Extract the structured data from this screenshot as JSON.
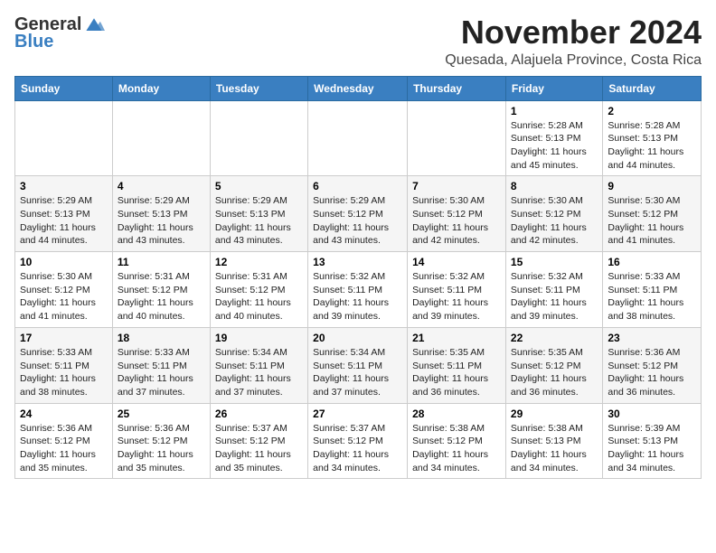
{
  "logo": {
    "general": "General",
    "blue": "Blue"
  },
  "header": {
    "month": "November 2024",
    "location": "Quesada, Alajuela Province, Costa Rica"
  },
  "weekdays": [
    "Sunday",
    "Monday",
    "Tuesday",
    "Wednesday",
    "Thursday",
    "Friday",
    "Saturday"
  ],
  "weeks": [
    [
      {
        "day": "",
        "info": ""
      },
      {
        "day": "",
        "info": ""
      },
      {
        "day": "",
        "info": ""
      },
      {
        "day": "",
        "info": ""
      },
      {
        "day": "",
        "info": ""
      },
      {
        "day": "1",
        "info": "Sunrise: 5:28 AM\nSunset: 5:13 PM\nDaylight: 11 hours\nand 45 minutes."
      },
      {
        "day": "2",
        "info": "Sunrise: 5:28 AM\nSunset: 5:13 PM\nDaylight: 11 hours\nand 44 minutes."
      }
    ],
    [
      {
        "day": "3",
        "info": "Sunrise: 5:29 AM\nSunset: 5:13 PM\nDaylight: 11 hours\nand 44 minutes."
      },
      {
        "day": "4",
        "info": "Sunrise: 5:29 AM\nSunset: 5:13 PM\nDaylight: 11 hours\nand 43 minutes."
      },
      {
        "day": "5",
        "info": "Sunrise: 5:29 AM\nSunset: 5:13 PM\nDaylight: 11 hours\nand 43 minutes."
      },
      {
        "day": "6",
        "info": "Sunrise: 5:29 AM\nSunset: 5:12 PM\nDaylight: 11 hours\nand 43 minutes."
      },
      {
        "day": "7",
        "info": "Sunrise: 5:30 AM\nSunset: 5:12 PM\nDaylight: 11 hours\nand 42 minutes."
      },
      {
        "day": "8",
        "info": "Sunrise: 5:30 AM\nSunset: 5:12 PM\nDaylight: 11 hours\nand 42 minutes."
      },
      {
        "day": "9",
        "info": "Sunrise: 5:30 AM\nSunset: 5:12 PM\nDaylight: 11 hours\nand 41 minutes."
      }
    ],
    [
      {
        "day": "10",
        "info": "Sunrise: 5:30 AM\nSunset: 5:12 PM\nDaylight: 11 hours\nand 41 minutes."
      },
      {
        "day": "11",
        "info": "Sunrise: 5:31 AM\nSunset: 5:12 PM\nDaylight: 11 hours\nand 40 minutes."
      },
      {
        "day": "12",
        "info": "Sunrise: 5:31 AM\nSunset: 5:12 PM\nDaylight: 11 hours\nand 40 minutes."
      },
      {
        "day": "13",
        "info": "Sunrise: 5:32 AM\nSunset: 5:11 PM\nDaylight: 11 hours\nand 39 minutes."
      },
      {
        "day": "14",
        "info": "Sunrise: 5:32 AM\nSunset: 5:11 PM\nDaylight: 11 hours\nand 39 minutes."
      },
      {
        "day": "15",
        "info": "Sunrise: 5:32 AM\nSunset: 5:11 PM\nDaylight: 11 hours\nand 39 minutes."
      },
      {
        "day": "16",
        "info": "Sunrise: 5:33 AM\nSunset: 5:11 PM\nDaylight: 11 hours\nand 38 minutes."
      }
    ],
    [
      {
        "day": "17",
        "info": "Sunrise: 5:33 AM\nSunset: 5:11 PM\nDaylight: 11 hours\nand 38 minutes."
      },
      {
        "day": "18",
        "info": "Sunrise: 5:33 AM\nSunset: 5:11 PM\nDaylight: 11 hours\nand 37 minutes."
      },
      {
        "day": "19",
        "info": "Sunrise: 5:34 AM\nSunset: 5:11 PM\nDaylight: 11 hours\nand 37 minutes."
      },
      {
        "day": "20",
        "info": "Sunrise: 5:34 AM\nSunset: 5:11 PM\nDaylight: 11 hours\nand 37 minutes."
      },
      {
        "day": "21",
        "info": "Sunrise: 5:35 AM\nSunset: 5:11 PM\nDaylight: 11 hours\nand 36 minutes."
      },
      {
        "day": "22",
        "info": "Sunrise: 5:35 AM\nSunset: 5:12 PM\nDaylight: 11 hours\nand 36 minutes."
      },
      {
        "day": "23",
        "info": "Sunrise: 5:36 AM\nSunset: 5:12 PM\nDaylight: 11 hours\nand 36 minutes."
      }
    ],
    [
      {
        "day": "24",
        "info": "Sunrise: 5:36 AM\nSunset: 5:12 PM\nDaylight: 11 hours\nand 35 minutes."
      },
      {
        "day": "25",
        "info": "Sunrise: 5:36 AM\nSunset: 5:12 PM\nDaylight: 11 hours\nand 35 minutes."
      },
      {
        "day": "26",
        "info": "Sunrise: 5:37 AM\nSunset: 5:12 PM\nDaylight: 11 hours\nand 35 minutes."
      },
      {
        "day": "27",
        "info": "Sunrise: 5:37 AM\nSunset: 5:12 PM\nDaylight: 11 hours\nand 34 minutes."
      },
      {
        "day": "28",
        "info": "Sunrise: 5:38 AM\nSunset: 5:12 PM\nDaylight: 11 hours\nand 34 minutes."
      },
      {
        "day": "29",
        "info": "Sunrise: 5:38 AM\nSunset: 5:13 PM\nDaylight: 11 hours\nand 34 minutes."
      },
      {
        "day": "30",
        "info": "Sunrise: 5:39 AM\nSunset: 5:13 PM\nDaylight: 11 hours\nand 34 minutes."
      }
    ]
  ]
}
